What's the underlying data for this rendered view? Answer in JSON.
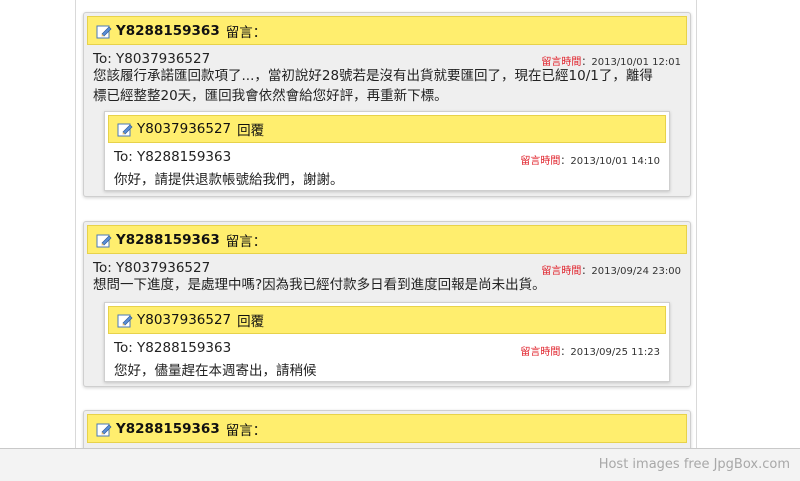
{
  "messages": [
    {
      "sender": "Y8288159363",
      "label": "留言：",
      "to": "To: Y8037936527",
      "time_label": "留言時間",
      "time": "：2013/10/01 12:01",
      "body_line1": "您該履行承諾匯回款項了...，當初說好28號若是沒有出貨就要匯回了，現在已經10/1了，離得",
      "body_line2": "標已經整整20天，匯回我會依然會給您好評，再重新下標。",
      "reply": {
        "sender": "Y8037936527",
        "label": "回覆",
        "to": "To: Y8288159363",
        "time_label": "留言時間",
        "time": "：2013/10/01 14:10",
        "body": "你好，請提供退款帳號給我們，謝謝。"
      }
    },
    {
      "sender": "Y8288159363",
      "label": "留言：",
      "to": "To: Y8037936527",
      "time_label": "留言時間",
      "time": "：2013/09/24 23:00",
      "body_line1": "想問一下進度，是處理中嗎?因為我已經付款多日看到進度回報是尚未出貨。",
      "reply": {
        "sender": "Y8037936527",
        "label": "回覆",
        "to": "To: Y8288159363",
        "time_label": "留言時間",
        "time": "：2013/09/25 11:23",
        "body": "您好，儘量趕在本週寄出，請稍候"
      }
    },
    {
      "sender": "Y8288159363",
      "label": "留言："
    }
  ],
  "footer": {
    "text": "Host images free JpgBox.com"
  },
  "colors": {
    "header_yellow": "#ffee6e",
    "time_label_red": "#e0202a"
  },
  "icons": {
    "header_icon": "edit-icon"
  }
}
